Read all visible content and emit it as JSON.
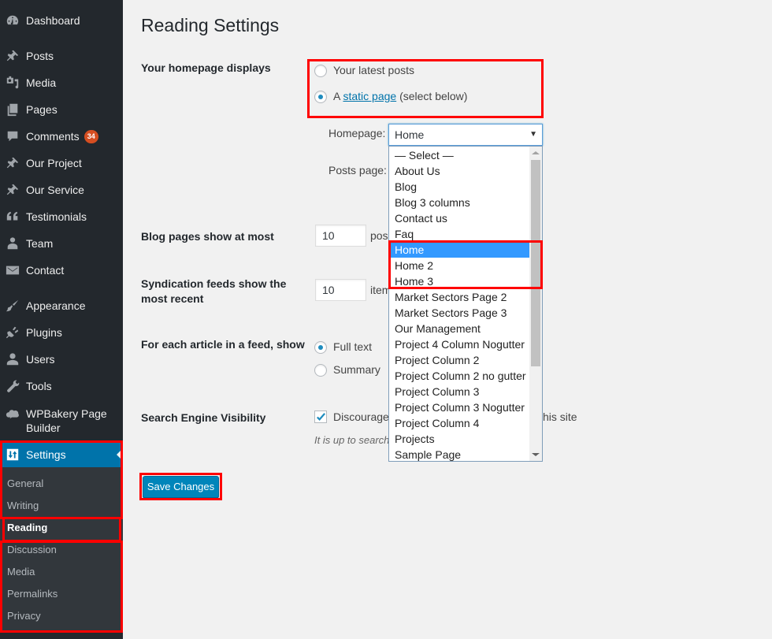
{
  "sidebar": {
    "items": [
      {
        "label": "Dashboard",
        "icon": "dashboard-icon"
      },
      {
        "label": "Posts",
        "icon": "pushpin-icon"
      },
      {
        "label": "Media",
        "icon": "media-icon"
      },
      {
        "label": "Pages",
        "icon": "pages-icon"
      },
      {
        "label": "Comments",
        "icon": "comment-icon",
        "badge": "34"
      },
      {
        "label": "Our Project",
        "icon": "pushpin-icon"
      },
      {
        "label": "Our Service",
        "icon": "pushpin-icon"
      },
      {
        "label": "Testimonials",
        "icon": "quote-icon"
      },
      {
        "label": "Team",
        "icon": "team-icon"
      },
      {
        "label": "Contact",
        "icon": "envelope-icon"
      },
      {
        "label": "Appearance",
        "icon": "paintbrush-icon"
      },
      {
        "label": "Plugins",
        "icon": "plugin-icon"
      },
      {
        "label": "Users",
        "icon": "user-icon"
      },
      {
        "label": "Tools",
        "icon": "wrench-icon"
      },
      {
        "label": "WPBakery Page Builder",
        "icon": "cloud-icon"
      },
      {
        "label": "Settings",
        "icon": "settings-sliders-icon"
      }
    ],
    "submenu": [
      {
        "label": "General"
      },
      {
        "label": "Writing"
      },
      {
        "label": "Reading",
        "active": true
      },
      {
        "label": "Discussion"
      },
      {
        "label": "Media"
      },
      {
        "label": "Permalinks"
      },
      {
        "label": "Privacy"
      }
    ]
  },
  "page": {
    "title": "Reading Settings",
    "homepage_displays": {
      "label": "Your homepage displays",
      "option_latest": "Your latest posts",
      "option_static_prefix": "A",
      "option_static_link": "static page",
      "option_static_suffix": "(select below)",
      "selected": "static"
    },
    "homepage_select": {
      "label": "Homepage:",
      "value": "Home"
    },
    "posts_page_select": {
      "label": "Posts page:"
    },
    "dropdown_options": [
      "— Select —",
      "About Us",
      "Blog",
      "Blog 3 columns",
      "Contact us",
      "Faq",
      "Home",
      "Home 2",
      "Home 3",
      "Market Sectors Page 2",
      "Market Sectors Page 3",
      "Our Management",
      "Project 4 Column Nogutter",
      "Project Column 2",
      "Project Column 2 no gutter",
      "Project Column 3",
      "Project Column 3 Nogutter",
      "Project Column 4",
      "Projects",
      "Sample Page"
    ],
    "dropdown_selected": "Home",
    "blog_pages": {
      "label": "Blog pages show at most",
      "value": "10",
      "suffix": "pos"
    },
    "syndication": {
      "label_line1": "Syndication feeds show the",
      "label_line2": "most recent",
      "value": "10",
      "suffix": "item"
    },
    "feed_article": {
      "label": "For each article in a feed, show",
      "option_full": "Full text",
      "option_summary": "Summary",
      "selected": "full"
    },
    "search_engine": {
      "label": "Search Engine Visibility",
      "checkbox_label_visible": "Discourage",
      "checkbox_label_tail": "his site",
      "checked": true,
      "description": "It is up to search"
    },
    "save_button": "Save Changes"
  },
  "colors": {
    "sidebar_bg": "#23282d",
    "submenu_bg": "#32373c",
    "accent": "#0073aa",
    "button": "#0085ba",
    "highlight_box": "#ff0000",
    "selected_option": "#3399ff",
    "badge": "#d54e21"
  }
}
